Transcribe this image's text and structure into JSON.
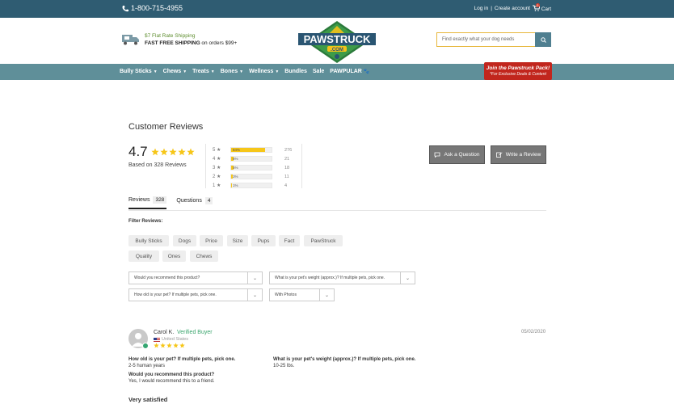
{
  "topbar": {
    "phone": "1-800-715-4955",
    "login": "Log in",
    "sep": "|",
    "create": "Create account",
    "cart": "Cart",
    "cart_count": "0"
  },
  "header": {
    "shipping_line1": "$7 Flat Rate Shipping",
    "shipping_line2_bold": "FAST FREE SHIPPING",
    "shipping_line2_rest": " on orders $99+",
    "logo_text": "PAWSTRUCK",
    "logo_sub": ".COM",
    "search_placeholder": "Find exactly what your dog needs"
  },
  "nav": {
    "items": [
      "Bully Sticks",
      "Chews",
      "Treats",
      "Bones",
      "Wellness",
      "Bundles",
      "Sale",
      "PAWPULAR"
    ],
    "join_line1": "Join the Pawstruck Pack!",
    "join_line2": "*For Exclusive Deals & Content"
  },
  "reviews": {
    "title": "Customer Reviews",
    "average": "4.7",
    "based_on": "Based on 328 Reviews",
    "histogram": [
      {
        "label": "5 ★",
        "percent": 84,
        "pct_text": "84%",
        "count": "276"
      },
      {
        "label": "4 ★",
        "percent": 6,
        "pct_text": "6%",
        "count": "21"
      },
      {
        "label": "3 ★",
        "percent": 5,
        "pct_text": "5%",
        "count": "18"
      },
      {
        "label": "2 ★",
        "percent": 3,
        "pct_text": "3%",
        "count": "11"
      },
      {
        "label": "1 ★",
        "percent": 1,
        "pct_text": "1%",
        "count": "4"
      }
    ],
    "ask_button": "Ask a Question",
    "write_button": "Write a Review",
    "tabs": [
      {
        "label": "Reviews",
        "count": "328"
      },
      {
        "label": "Questions",
        "count": "4"
      }
    ],
    "filter_label": "Filter Reviews:",
    "chips": [
      "Bully Sticks",
      "Dogs",
      "Price",
      "Size",
      "Pups",
      "Fact",
      "PawStruck",
      "Quality",
      "Ones",
      "Chews"
    ],
    "selects": [
      "Would you recommend this product?",
      "What is your pet's weight (approx.)? If multiple pets, pick one.",
      "How old is your pet? If multiple pets, pick one.",
      "With Photos"
    ]
  },
  "review": {
    "name": "Carol K.",
    "verified": "Verified Buyer",
    "location": "United States",
    "date": "05/02/2020",
    "q1": "How old is your pet? If multiple pets, pick one.",
    "a1": "2-5 human years",
    "q2": "What is your pet's weight (approx.)? If multiple pets, pick one.",
    "a2": "10-25 lbs.",
    "q3": "Would you recommend this product?",
    "a3": "Yes, I would recommend this to a friend.",
    "headline": "Very satisfied"
  },
  "colors": {
    "topbar": "#2f5c72",
    "nav": "#5f8f99",
    "star": "#f6c619",
    "verified": "#3aa56d",
    "join": "#c1261d"
  }
}
